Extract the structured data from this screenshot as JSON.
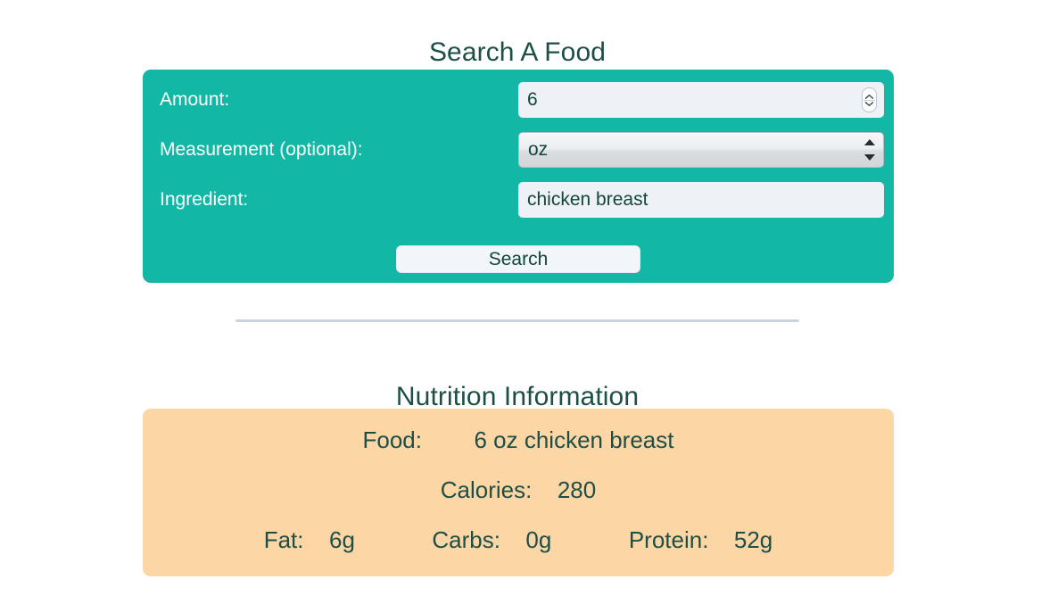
{
  "page": {
    "title": "Search A Food",
    "section_title": "Nutrition Information"
  },
  "form": {
    "amount": {
      "label": "Amount:",
      "value": "6",
      "placeholder": "",
      "spinner_up_icon": "chevron-up-icon",
      "spinner_down_icon": "chevron-down-icon"
    },
    "measurement": {
      "label": "Measurement (optional):",
      "selected": "oz",
      "options": [
        "oz"
      ],
      "arrow_up_icon": "triangle-up-icon",
      "arrow_down_icon": "triangle-down-icon"
    },
    "ingredient": {
      "label": "Ingredient:",
      "value": "chicken breast",
      "placeholder": ""
    },
    "submit_label": "Search"
  },
  "nutrition": {
    "food_label": "Food:",
    "food_value": "6 oz chicken breast",
    "calories_label": "Calories:",
    "calories_value": "280",
    "fat_label": "Fat:",
    "fat_value": "6g",
    "carbs_label": "Carbs:",
    "carbs_value": "0g",
    "protein_label": "Protein:",
    "protein_value": "52g"
  },
  "colors": {
    "form_panel": "#13b7a5",
    "nutrition_panel": "#fdd6a6",
    "heading_text": "#1d4f47",
    "input_background": "#eef2f7",
    "divider": "#ccd3df"
  }
}
